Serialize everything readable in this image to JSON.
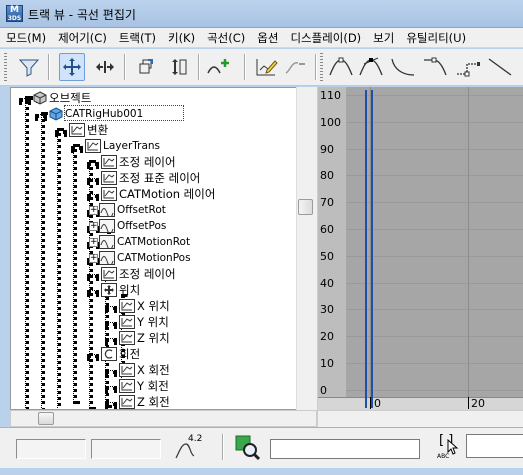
{
  "window": {
    "title": "트랙 뷰 - 곡선 편집기",
    "app_icon_top": "M",
    "app_icon_bottom": "3DS"
  },
  "menubar": {
    "items": [
      "모드(M)",
      "제어기(C)",
      "트랙(T)",
      "키(K)",
      "곡선(C)",
      "옵션",
      "디스플레이(D)",
      "보기",
      "유틸리티(U)"
    ]
  },
  "toolbar": {
    "buttons": [
      {
        "name": "filter-icon"
      },
      {
        "name": "move-keys-icon",
        "active": true
      },
      {
        "name": "move-horizontal-icon"
      },
      {
        "name": "slide-keys-icon"
      },
      {
        "name": "scale-keys-icon"
      },
      {
        "name": "add-keys-icon"
      },
      {
        "name": "draw-curves-icon"
      },
      {
        "name": "reduce-keys-icon"
      },
      {
        "name": "tangent-auto-icon"
      },
      {
        "name": "tangent-custom-icon"
      },
      {
        "name": "tangent-fast-icon"
      },
      {
        "name": "tangent-slow-icon"
      },
      {
        "name": "tangent-step-icon"
      },
      {
        "name": "tangent-linear-icon"
      }
    ]
  },
  "tree": {
    "nodes": [
      {
        "label": "오브젝트",
        "depth": 0
      },
      {
        "label": "CATRigHub001",
        "depth": 1
      },
      {
        "label": "변환",
        "depth": 2
      },
      {
        "label": "LayerTrans",
        "depth": 3
      },
      {
        "label": "조정 레이어",
        "depth": 4
      },
      {
        "label": "조정 표준 레이어",
        "depth": 4
      },
      {
        "label": "CATMotion 레이어",
        "depth": 4
      },
      {
        "label": "OffsetRot",
        "depth": 5
      },
      {
        "label": "OffsetPos",
        "depth": 5
      },
      {
        "label": "CATMotionRot",
        "depth": 5
      },
      {
        "label": "CATMotionPos",
        "depth": 5
      },
      {
        "label": "조정 레이어",
        "depth": 4
      },
      {
        "label": "위치",
        "depth": 5
      },
      {
        "label": "X 위치",
        "depth": 6
      },
      {
        "label": "Y 위치",
        "depth": 6
      },
      {
        "label": "Z 위치",
        "depth": 6
      },
      {
        "label": "회전",
        "depth": 5
      },
      {
        "label": "X 회전",
        "depth": 6
      },
      {
        "label": "Y 회전",
        "depth": 6
      },
      {
        "label": "Z 회전",
        "depth": 6
      }
    ]
  },
  "curve_editor": {
    "y_axis": [
      "110",
      "100",
      "90",
      "80",
      "70",
      "60",
      "50",
      "40",
      "30",
      "20",
      "10",
      "0"
    ],
    "x_axis": [
      "0",
      "20"
    ],
    "background": "#a6a6a6",
    "keyline_color": "#1f4fa8"
  },
  "statusbar": {
    "key_value_label": "4.2",
    "brackets_label": "[ ]",
    "abc_label": "ABC"
  }
}
